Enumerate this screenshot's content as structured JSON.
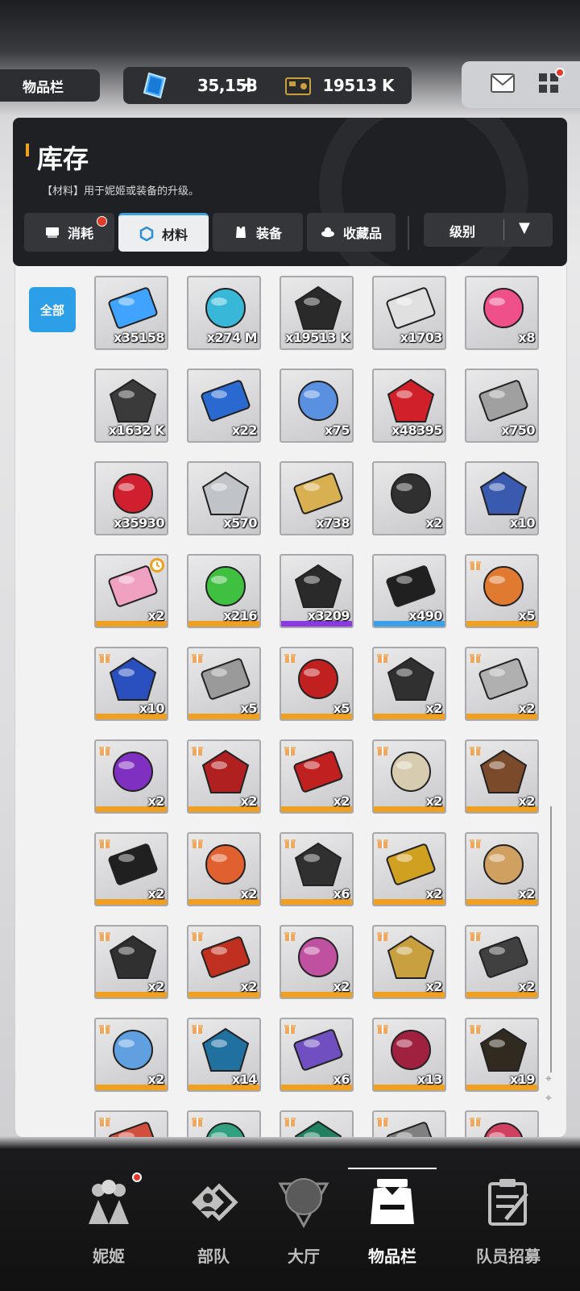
{
  "header": {
    "title": "物品栏",
    "gem_amount": "35,158",
    "gem_add": "+",
    "credit_amount": "19513 K"
  },
  "inventory": {
    "title": "库存",
    "description": "【材料】用于妮姬或装备的升级。",
    "tabs": [
      {
        "label": "消耗",
        "icon": "consumable-icon",
        "active": false,
        "badge": true
      },
      {
        "label": "材料",
        "icon": "hexagon-icon",
        "active": true,
        "badge": false
      },
      {
        "label": "装备",
        "icon": "vest-icon",
        "active": false,
        "badge": false
      },
      {
        "label": "收藏品",
        "icon": "collectible-icon",
        "active": false,
        "badge": false
      }
    ],
    "sort_label": "级别",
    "filter_all": "全部"
  },
  "items": [
    {
      "name": "gem-icon",
      "count": "x35158",
      "color": "#3fa3ff"
    },
    {
      "name": "usb-drive-icon",
      "count": "x274 M",
      "color": "#38b8d8"
    },
    {
      "name": "credit-card-icon",
      "count": "x19513 K",
      "color": "#2a2a2a"
    },
    {
      "name": "core-orb-icon",
      "count": "x1703",
      "color": "#e0e0e0"
    },
    {
      "name": "heart-gem-icon",
      "count": "x8",
      "color": "#f0508a"
    },
    {
      "name": "ticket-icon",
      "count": "x1632 K",
      "color": "#3a3a3a"
    },
    {
      "name": "blue-card-icon",
      "count": "x22",
      "color": "#2a6ad0"
    },
    {
      "name": "rainbow-card-icon",
      "count": "x75",
      "color": "#5a90e0"
    },
    {
      "name": "red-core-icon",
      "count": "x48395",
      "color": "#d0202a"
    },
    {
      "name": "dna-module-icon",
      "count": "x750",
      "color": "#a0a0a0"
    },
    {
      "name": "red-module-icon",
      "count": "x35930",
      "color": "#d02030"
    },
    {
      "name": "silver-wing-card-icon",
      "count": "x570",
      "color": "#c0c4c8"
    },
    {
      "name": "gold-wing-card-icon",
      "count": "x738",
      "color": "#d8b050"
    },
    {
      "name": "infinity-chip-icon",
      "count": "x2",
      "color": "#303030"
    },
    {
      "name": "lanyard-badge-icon",
      "count": "x10",
      "color": "#3a5ab0"
    },
    {
      "name": "mirror-icon",
      "count": "x2",
      "color": "#f0a0c0",
      "rarity": "#f0a020",
      "clock": true
    },
    {
      "name": "green-circuit-icon",
      "count": "x216",
      "color": "#40c040",
      "rarity": "#f0a020"
    },
    {
      "name": "black-device-icon",
      "count": "x3209",
      "color": "#2a2a2a",
      "rarity": "#8a3ae0"
    },
    {
      "name": "dark-device-icon",
      "count": "x490",
      "color": "#202020",
      "rarity": "#3aa0e8"
    },
    {
      "name": "fox-plush-icon",
      "count": "x5",
      "color": "#e07a30",
      "rarity": "#f0a020",
      "gift": true
    },
    {
      "name": "gamepad-icon",
      "count": "x10",
      "color": "#2a50c0",
      "rarity": "#f0a020",
      "gift": true
    },
    {
      "name": "rabbit-card-icon",
      "count": "x5",
      "color": "#9a9a9a",
      "rarity": "#f0a020",
      "gift": true
    },
    {
      "name": "pet-bowl-icon",
      "count": "x5",
      "color": "#c02020",
      "rarity": "#f0a020",
      "gift": true
    },
    {
      "name": "ssd-icon",
      "count": "x2",
      "color": "#303030",
      "rarity": "#f0a020",
      "gift": true
    },
    {
      "name": "emblem-coin-icon",
      "count": "x2",
      "color": "#b0b0b0",
      "rarity": "#f0a020",
      "gift": true
    },
    {
      "name": "wireless-charger-icon",
      "count": "x2",
      "color": "#8030c0",
      "rarity": "#f0a020",
      "gift": true
    },
    {
      "name": "red-book-icon",
      "count": "x2",
      "color": "#b02020",
      "rarity": "#f0a020",
      "gift": true
    },
    {
      "name": "red-rope-icon",
      "count": "x2",
      "color": "#c02020",
      "rarity": "#f0a020",
      "gift": true
    },
    {
      "name": "old-paper-icon",
      "count": "x2",
      "color": "#d8ccb0",
      "rarity": "#f0a020",
      "gift": true
    },
    {
      "name": "coffee-sticks-icon",
      "count": "x2",
      "color": "#7a4a2a",
      "rarity": "#f0a020",
      "gift": true
    },
    {
      "name": "stethoscope-icon",
      "count": "x2",
      "color": "#202020",
      "rarity": "#f0a020",
      "gift": true
    },
    {
      "name": "pen-icon",
      "count": "x2",
      "color": "#e06030",
      "rarity": "#f0a020",
      "gift": true
    },
    {
      "name": "push-remote-icon",
      "count": "x6",
      "color": "#303030",
      "rarity": "#f0a020",
      "gift": true
    },
    {
      "name": "car-battery-icon",
      "count": "x2",
      "color": "#d0a020",
      "rarity": "#f0a020",
      "gift": true
    },
    {
      "name": "snack-bag-icon",
      "count": "x2",
      "color": "#d0a060",
      "rarity": "#f0a020",
      "gift": true
    },
    {
      "name": "toolbox-icon",
      "count": "x2",
      "color": "#303030",
      "rarity": "#f0a020",
      "gift": true
    },
    {
      "name": "toy-train-icon",
      "count": "x2",
      "color": "#c03020",
      "rarity": "#f0a020",
      "gift": true
    },
    {
      "name": "crystal-pack-icon",
      "count": "x2",
      "color": "#c050a0",
      "rarity": "#f0a020",
      "gift": true
    },
    {
      "name": "gold-badge-icon",
      "count": "x2",
      "color": "#c8a040",
      "rarity": "#f0a020",
      "gift": true
    },
    {
      "name": "walkie-talkie-icon",
      "count": "x2",
      "color": "#404040",
      "rarity": "#f0a020",
      "gift": true
    },
    {
      "name": "water-bottles-icon",
      "count": "x2",
      "color": "#60a0e0",
      "rarity": "#f0a020",
      "gift": true
    },
    {
      "name": "blue-ticket-icon",
      "count": "x14",
      "color": "#2070a0",
      "rarity": "#f0a020",
      "gift": true
    },
    {
      "name": "purple-ticket-icon",
      "count": "x6",
      "color": "#7050c0",
      "rarity": "#f0a020",
      "gift": true
    },
    {
      "name": "vip-beauty-card-icon",
      "count": "x13",
      "color": "#a02040",
      "rarity": "#f0a020",
      "gift": true
    },
    {
      "name": "vip-gold-card-icon",
      "count": "x19",
      "color": "#302a20",
      "rarity": "#f0a020",
      "gift": true
    },
    {
      "name": "partial-item-1-icon",
      "count": "",
      "color": "#d05040",
      "gift": true
    },
    {
      "name": "partial-item-2-icon",
      "count": "",
      "color": "#30a080",
      "gift": true
    },
    {
      "name": "partial-item-3-icon",
      "count": "",
      "color": "#208060",
      "gift": true
    },
    {
      "name": "partial-item-4-icon",
      "count": "",
      "color": "#808080",
      "gift": true
    },
    {
      "name": "partial-item-5-icon",
      "count": "",
      "color": "#d04060",
      "gift": true
    }
  ],
  "nav": [
    {
      "label": "妮姬",
      "icon": "nikke-icon",
      "active": false,
      "badge": true
    },
    {
      "label": "部队",
      "icon": "squad-icon",
      "active": false,
      "badge": false
    },
    {
      "label": "大厅",
      "icon": "lobby-icon",
      "active": false,
      "badge": false
    },
    {
      "label": "物品栏",
      "icon": "inventory-icon",
      "active": true,
      "badge": false
    },
    {
      "label": "队员招募",
      "icon": "recruit-icon",
      "active": false,
      "badge": false
    }
  ]
}
